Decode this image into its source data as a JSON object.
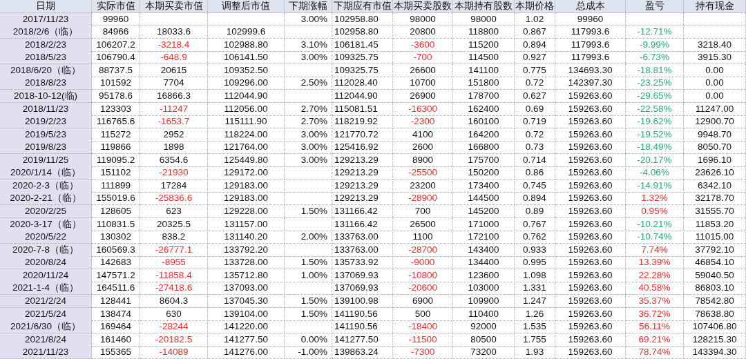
{
  "table": {
    "columns": [
      "日期",
      "实际市值",
      "本期买卖市值",
      "调整后市值",
      "下期涨幅",
      "下期应有市值",
      "本期买卖股数",
      "本期持有股数",
      "本期价格",
      "总成本",
      "盈亏",
      "持有现金"
    ],
    "rows": [
      [
        "2017/11/23",
        "99960",
        "",
        "",
        "3.00%",
        "102958.80",
        "98000",
        "98000",
        "1.02",
        "99960",
        "",
        ""
      ],
      [
        "2018/2/6（临）",
        "84966",
        "18033.6",
        "102999.6",
        "",
        "102958.80",
        "20800",
        "118800",
        "0.867",
        "117993.6",
        {
          "text": "-12.71%",
          "color": "#22b26e"
        },
        ""
      ],
      [
        "2018/2/23",
        "106207.2",
        {
          "text": "-3218.4",
          "color": "#ff2a2a"
        },
        "102988.80",
        "3.10%",
        "106181.45",
        {
          "text": "-3600",
          "color": "#ff2a2a"
        },
        "115200",
        "0.894",
        "117993.6",
        {
          "text": "-9.99%",
          "color": "#22b26e"
        },
        "3218.40"
      ],
      [
        "2018/5/23",
        "106790.4",
        {
          "text": "-648.9",
          "color": "#ff2a2a"
        },
        "106141.50",
        "3.00%",
        "109325.75",
        {
          "text": "-700",
          "color": "#ff2a2a"
        },
        "114500",
        "0.927",
        "117993.6",
        {
          "text": "-6.73%",
          "color": "#22b26e"
        },
        "3915.30"
      ],
      [
        "2018/6/20（临）",
        "88737.5",
        "20615",
        "109352.50",
        "",
        "109325.75",
        "26600",
        "141100",
        "0.775",
        "134693.30",
        {
          "text": "-18.81%",
          "color": "#22b26e"
        },
        "0.00"
      ],
      [
        "2018/8/23",
        "101592",
        "7704",
        "109296.00",
        "2.50%",
        "112028.40",
        "10700",
        "151800",
        "0.72",
        "142397.30",
        {
          "text": "-23.25%",
          "color": "#22b26e"
        },
        "0.00"
      ],
      [
        "2018-10-12(临)",
        "95178.6",
        "16866.3",
        "112044.90",
        "",
        "112044.90",
        "26900",
        "178700",
        "0.627",
        "159263.60",
        {
          "text": "-29.65%",
          "color": "#22b26e"
        },
        "0.00"
      ],
      [
        "2018/11/23",
        "123303",
        {
          "text": "-11247",
          "color": "#ff2a2a"
        },
        "112056.00",
        "2.70%",
        "115081.51",
        {
          "text": "-16300",
          "color": "#ff2a2a"
        },
        "162400",
        "0.69",
        "159263.60",
        {
          "text": "-22.58%",
          "color": "#22b26e"
        },
        "11247.00"
      ],
      [
        "2019/2/23",
        "116765.6",
        {
          "text": "-1653.7",
          "color": "#ff2a2a"
        },
        "115111.90",
        "2.70%",
        "118219.92",
        {
          "text": "-2300",
          "color": "#ff2a2a"
        },
        "160100",
        "0.719",
        "159263.60",
        {
          "text": "-19.62%",
          "color": "#22b26e"
        },
        "12900.70"
      ],
      [
        "2019/5/23",
        "115272",
        "2952",
        "118224.00",
        "3.00%",
        "121770.72",
        "4100",
        "164200",
        "0.72",
        "159263.60",
        {
          "text": "-19.52%",
          "color": "#22b26e"
        },
        "9948.70"
      ],
      [
        "2019/8/23",
        "119866",
        "1898",
        "121764.00",
        "3.00%",
        "125416.92",
        "2600",
        "166800",
        "0.73",
        "159263.60",
        {
          "text": "-18.49%",
          "color": "#22b26e"
        },
        "8050.70"
      ],
      [
        "2019/11/25",
        "119095.2",
        "6354.6",
        "125449.80",
        "3.00%",
        "129213.29",
        "8900",
        "175700",
        "0.714",
        "159263.60",
        {
          "text": "-20.17%",
          "color": "#22b26e"
        },
        "1696.10"
      ],
      [
        "2020/1/14（临）",
        "151102",
        {
          "text": "-21930",
          "color": "#ff2a2a"
        },
        "129172.00",
        "",
        "129213.29",
        {
          "text": "-25500",
          "color": "#ff2a2a"
        },
        "150200",
        "0.86",
        "159263.60",
        {
          "text": "-4.06%",
          "color": "#22b26e"
        },
        "23626.10"
      ],
      [
        "2020-2-3（临）",
        "111899",
        "17284",
        "129183.00",
        "",
        "129213.29",
        "23200",
        "173400",
        "0.745",
        "159263.60",
        {
          "text": "-14.91%",
          "color": "#22b26e"
        },
        "6342.10"
      ],
      [
        "2020-2-21（临）",
        "155019.6",
        {
          "text": "-25836.6",
          "color": "#ff2a2a"
        },
        "129183.00",
        "",
        "129213.29",
        {
          "text": "-28900",
          "color": "#ff2a2a"
        },
        "144500",
        "0.894",
        "159263.60",
        {
          "text": "1.32%",
          "color": "#ff2a2a"
        },
        "32178.70"
      ],
      [
        "2020/2/25",
        "128605",
        "623",
        "129228.00",
        "1.50%",
        "131166.42",
        "700",
        "145200",
        "0.89",
        "159263.60",
        {
          "text": "0.95%",
          "color": "#ff2a2a"
        },
        "31555.70"
      ],
      [
        "2020-3-17（临）",
        "110831.5",
        "20325.5",
        "131157.00",
        "",
        "131166.42",
        "26500",
        "171000",
        "0.767",
        "159263.60",
        {
          "text": "-10.21%",
          "color": "#22b26e"
        },
        "11853.20"
      ],
      [
        "2020/5/22",
        "130302",
        "838.2",
        "131140.20",
        "2.00%",
        "133763.00",
        "1100",
        "172100",
        "0.762",
        "159263.60",
        {
          "text": "-10.74%",
          "color": "#22b26e"
        },
        "11015.00"
      ],
      [
        "2020-7-8（临）",
        "160569.3",
        {
          "text": "-26777.1",
          "color": "#ff2a2a"
        },
        "133792.20",
        "",
        "133763.00",
        {
          "text": "-28700",
          "color": "#ff2a2a"
        },
        "143400",
        "0.933",
        "159263.60",
        {
          "text": "7.74%",
          "color": "#ff2a2a"
        },
        "37792.10"
      ],
      [
        "2020/8/24",
        "142683",
        {
          "text": "-8955",
          "color": "#ff2a2a"
        },
        "133728.00",
        "1.50%",
        "135733.92",
        {
          "text": "-9000",
          "color": "#ff2a2a"
        },
        "134400",
        "0.995",
        "159263.60",
        {
          "text": "13.39%",
          "color": "#ff2a2a"
        },
        "46854.10"
      ],
      [
        "2020/11/24",
        "147571.2",
        {
          "text": "-11858.4",
          "color": "#ff2a2a"
        },
        "135712.80",
        "1.00%",
        "137069.93",
        {
          "text": "-10800",
          "color": "#ff2a2a"
        },
        "123600",
        "1.098",
        "159263.60",
        {
          "text": "22.28%",
          "color": "#ff2a2a"
        },
        "59040.50"
      ],
      [
        "2021-1-4（临）",
        "164511.6",
        {
          "text": "-27418.6",
          "color": "#ff2a2a"
        },
        "137093.00",
        "",
        "137069.93",
        {
          "text": "-20600",
          "color": "#ff2a2a"
        },
        "103000",
        "1.331",
        "159263.60",
        {
          "text": "40.58%",
          "color": "#ff2a2a"
        },
        "86803.10"
      ],
      [
        "2021/2/24",
        "128441",
        "8604.3",
        "137045.30",
        "1.50%",
        "139100.98",
        "6900",
        "109900",
        "1.247",
        "159263.60",
        {
          "text": "35.37%",
          "color": "#ff2a2a"
        },
        "78542.80"
      ],
      [
        "2021/5/24",
        "138474",
        "630",
        "139104.00",
        "1.50%",
        "141190.56",
        "500",
        "110400",
        "1.26",
        "159263.60",
        {
          "text": "36.72%",
          "color": "#ff2a2a"
        },
        "78638.80"
      ],
      [
        "2021/6/30（临）",
        "169464",
        {
          "text": "-28244",
          "color": "#ff2a2a"
        },
        "141220.00",
        "",
        "141190.56",
        {
          "text": "-18400",
          "color": "#ff2a2a"
        },
        "92000",
        "1.535",
        "159263.60",
        {
          "text": "56.11%",
          "color": "#ff2a2a"
        },
        "107406.80"
      ],
      [
        "2021/8/24",
        "161460",
        {
          "text": "-20182.5",
          "color": "#ff2a2a"
        },
        "141277.50",
        "0.00%",
        "141277.50",
        {
          "text": "-11500",
          "color": "#ff2a2a"
        },
        "80500",
        "1.755",
        "159263.60",
        {
          "text": "69.21%",
          "color": "#ff2a2a"
        },
        "128215.30"
      ],
      [
        "2021/11/23",
        "155365",
        {
          "text": "-14089",
          "color": "#ff2a2a"
        },
        "141276.00",
        "-1.00%",
        "139863.24",
        {
          "text": "-7300",
          "color": "#ff2a2a"
        },
        "73200",
        "1.93",
        "159263.60",
        {
          "text": "78.74%",
          "color": "#ff2a2a"
        },
        "143394.30"
      ]
    ]
  }
}
